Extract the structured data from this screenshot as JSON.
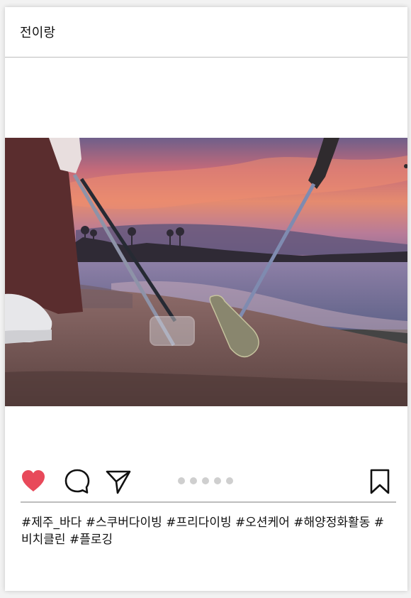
{
  "post": {
    "username": "전이랑",
    "caption": "#제주_바다 #스쿠버다이빙 #프리다이빙 #오션케어 #해양정화활동 #비치클린 #플로깅",
    "liked": true,
    "carousel": {
      "count": 5,
      "active_index": 0
    }
  },
  "icons": {
    "like": "heart-icon",
    "comment": "comment-bubble-icon",
    "share": "paper-plane-icon",
    "save": "bookmark-icon"
  },
  "colors": {
    "like_red": "#e8495a",
    "icon_stroke": "#111111",
    "dot_inactive": "#cfcfcf",
    "divider": "#bdbdbd"
  }
}
